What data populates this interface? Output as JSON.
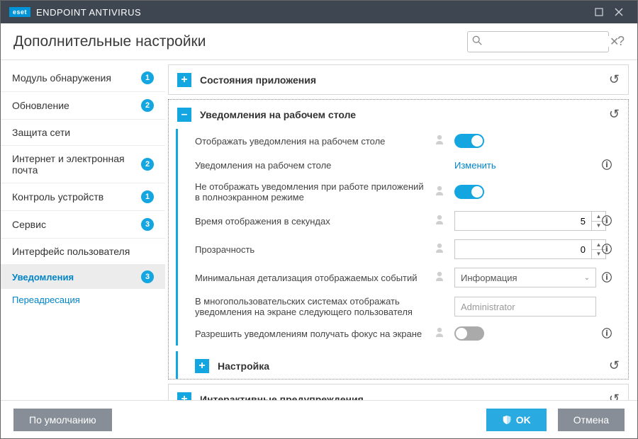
{
  "titlebar": {
    "logo": "eset",
    "product": "ENDPOINT ANTIVIRUS"
  },
  "header": {
    "title": "Дополнительные настройки",
    "search_placeholder": ""
  },
  "sidebar": [
    {
      "label": "Модуль обнаружения",
      "badge": "1",
      "sub": false
    },
    {
      "label": "Обновление",
      "badge": "2",
      "sub": false
    },
    {
      "label": "Защита сети",
      "badge": "",
      "sub": false
    },
    {
      "label": "Интернет и электронная почта",
      "badge": "2",
      "sub": false
    },
    {
      "label": "Контроль устройств",
      "badge": "1",
      "sub": false
    },
    {
      "label": "Сервис",
      "badge": "3",
      "sub": false
    },
    {
      "label": "Интерфейс пользователя",
      "badge": "",
      "sub": false
    },
    {
      "label": "Уведомления",
      "badge": "3",
      "sub": true,
      "active": true
    },
    {
      "label": "Переадресация",
      "badge": "",
      "sub": true,
      "active": false
    }
  ],
  "sections": {
    "app_states": {
      "title": "Состояния приложения",
      "open": false
    },
    "desktop": {
      "title": "Уведомления на рабочем столе",
      "open": true,
      "rows": {
        "show_desktop": {
          "label": "Отображать уведомления на рабочем столе",
          "toggle": true,
          "info": false,
          "policy": true
        },
        "desktop_link": {
          "label": "Уведомления на рабочем столе",
          "link": "Изменить",
          "info": true,
          "policy": false
        },
        "fullscreen": {
          "label": "Не отображать уведомления при работе приложений в полноэкранном режиме",
          "toggle": true,
          "info": false,
          "policy": true
        },
        "seconds": {
          "label": "Время отображения в секундах",
          "value": "5",
          "info": true,
          "policy": true
        },
        "transparency": {
          "label": "Прозрачность",
          "value": "0",
          "info": true,
          "policy": true
        },
        "min_detail": {
          "label": "Минимальная детализация отображаемых событий",
          "select": "Информация",
          "info": true,
          "policy": true
        },
        "multiuser": {
          "label": "В многопользовательских системах отображать уведомления на экране следующего пользователя",
          "text": "Administrator",
          "info": false,
          "policy": false
        },
        "focus": {
          "label": "Разрешить уведомлениям получать фокус на экране",
          "toggle": false,
          "info": true,
          "policy": true
        }
      },
      "sub_title": "Настройка"
    },
    "interactive": {
      "title": "Интерактивные предупреждения",
      "open": false
    }
  },
  "footer": {
    "default": "По умолчанию",
    "ok": "OK",
    "cancel": "Отмена"
  }
}
